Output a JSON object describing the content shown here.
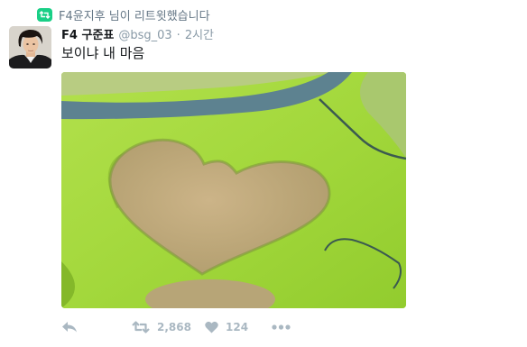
{
  "retweet_context": {
    "text": "F4윤지후 님이 리트윗했습니다",
    "icon": "retweet-icon",
    "accent_color": "#19cf86"
  },
  "tweet": {
    "display_name": "F4 구준표",
    "handle": "@bsg_03",
    "separator": "·",
    "time": "2시간",
    "text": "보이냐 내 마음",
    "media_icon": "photo-heart-field"
  },
  "actions": {
    "reply": {
      "icon": "reply-icon"
    },
    "retweet": {
      "icon": "retweet-icon",
      "count": "2,868"
    },
    "like": {
      "icon": "heart-icon",
      "count": "124"
    },
    "more": {
      "icon": "more-dots-icon"
    },
    "muted_color": "#aab8c2"
  }
}
